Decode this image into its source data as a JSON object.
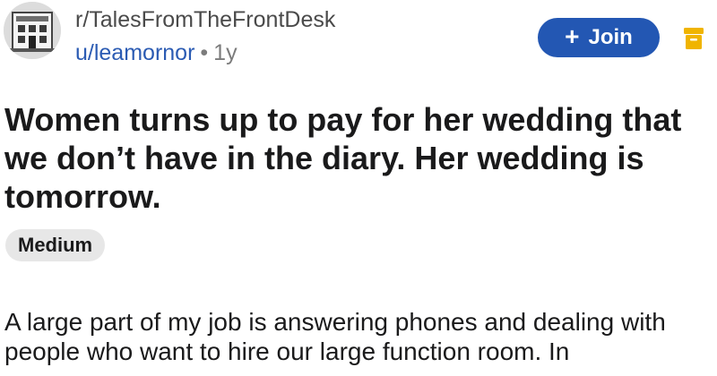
{
  "header": {
    "subreddit": "r/TalesFromTheFrontDesk",
    "author": "u/leamornor",
    "separator": "•",
    "age": "1y",
    "avatar_icon": "hotel-building-icon",
    "join_label": "Join",
    "join_icon": "plus-icon",
    "save_icon": "archive-icon"
  },
  "post": {
    "title": "Women turns up to pay for her wedding that we don’t have in the diary. Her wedding is tomorrow.",
    "flair": "Medium",
    "body": "A large part of my job is answering phones and dealing with people who want to hire our large function room. In"
  },
  "colors": {
    "join_bg": "#2357b3",
    "author_link": "#2b5bb3",
    "archive_icon": "#f0b400",
    "flair_bg": "#e7e7e7"
  }
}
